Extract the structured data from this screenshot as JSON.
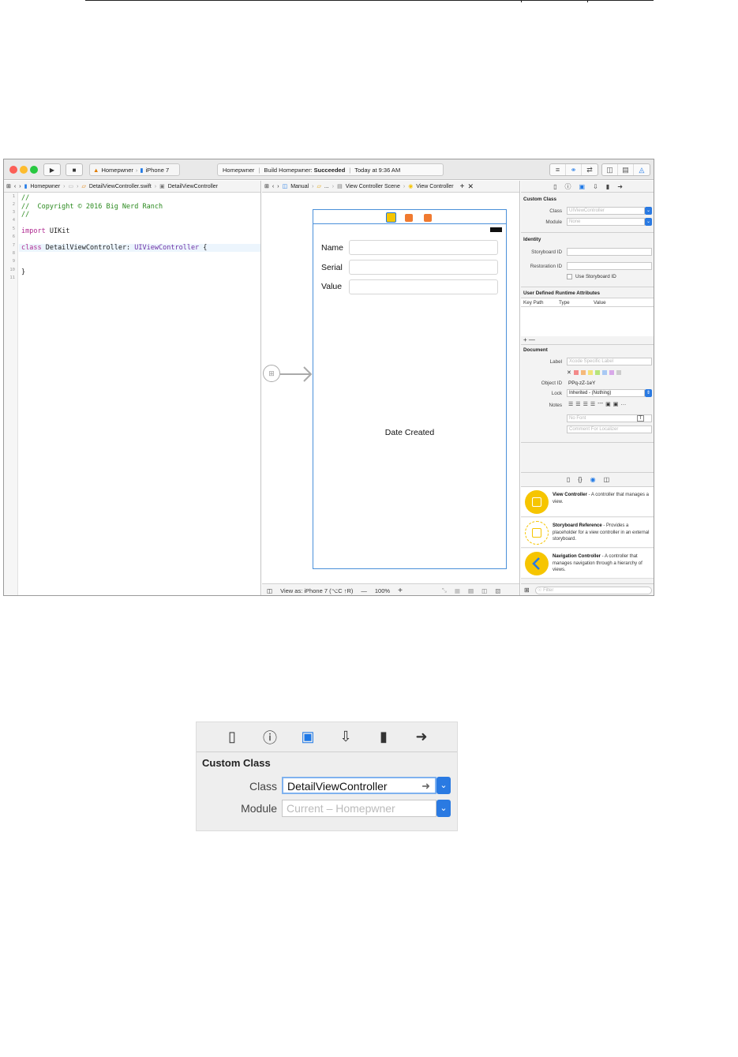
{
  "toolbar": {
    "scheme_name": "Homepwner",
    "device": "iPhone 7",
    "status_app": "Homepwner",
    "status_build": "Build Homepwner:",
    "status_result": "Succeeded",
    "status_time": "Today at 9:36 AM"
  },
  "editor": {
    "breadcrumb": [
      "Homepwner",
      "DetailViewController.swift",
      "DetailViewController"
    ],
    "line_numbers": [
      "1",
      "2",
      "3",
      "4",
      "5",
      "6",
      "7",
      "8",
      "9",
      "10",
      "11"
    ],
    "code": {
      "l1": "//",
      "l2": "//  Copyright © 2016 Big Nerd Ranch",
      "l3": "//",
      "l5_kw": "import",
      "l5_rest": " UIKit",
      "l7_kw": "class",
      "l7_name": " DetailViewController: ",
      "l7_type": "UIViewController",
      "l7_tail": " {",
      "l10": "}"
    }
  },
  "canvas": {
    "breadcrumb": [
      "Manual",
      "...",
      "View Controller Scene",
      "View Controller"
    ],
    "fields": [
      "Name",
      "Serial",
      "Value"
    ],
    "date_label": "Date Created",
    "view_as": "View as: iPhone 7 (⌥C ↑R)",
    "zoom": "100%"
  },
  "inspector": {
    "custom_class_title": "Custom Class",
    "class_label": "Class",
    "class_placeholder": "UIViewController",
    "module_label": "Module",
    "module_placeholder": "None",
    "identity_title": "Identity",
    "storyboard_id_label": "Storyboard ID",
    "restoration_id_label": "Restoration ID",
    "use_storyboard_id": "Use Storyboard ID",
    "runtime_title": "User Defined Runtime Attributes",
    "runtime_cols": [
      "Key Path",
      "Type",
      "Value"
    ],
    "plus_minus": "+ —",
    "document_title": "Document",
    "doc_label_label": "Label",
    "doc_label_placeholder": "Xcode Specific Label",
    "object_id_label": "Object ID",
    "object_id_value": "PPq-zZ-1eY",
    "lock_label": "Lock",
    "lock_value": "Inherited - (Nothing)",
    "notes_label": "Notes",
    "no_font": "No Font",
    "comment_placeholder": "Comment For Localizer",
    "filter_placeholder": "Filter",
    "library": [
      {
        "title": "View Controller",
        "desc": " - A controller that manages a view."
      },
      {
        "title": "Storyboard Reference",
        "desc": " - Provides a placeholder for a view controller in an external storyboard."
      },
      {
        "title": "Navigation Controller",
        "desc": " - A controller that manages navigation through a hierarchy of views."
      }
    ]
  },
  "zoomed": {
    "title": "Custom Class",
    "class_label": "Class",
    "class_value": "DetailViewController",
    "module_label": "Module",
    "module_placeholder": "Current – Homepwner"
  },
  "colors": {
    "accent": "#1e78e6",
    "close": "#fc5f57",
    "minimize": "#fdbc2e",
    "zoom": "#28c840",
    "library_icon": "#f6c500"
  }
}
